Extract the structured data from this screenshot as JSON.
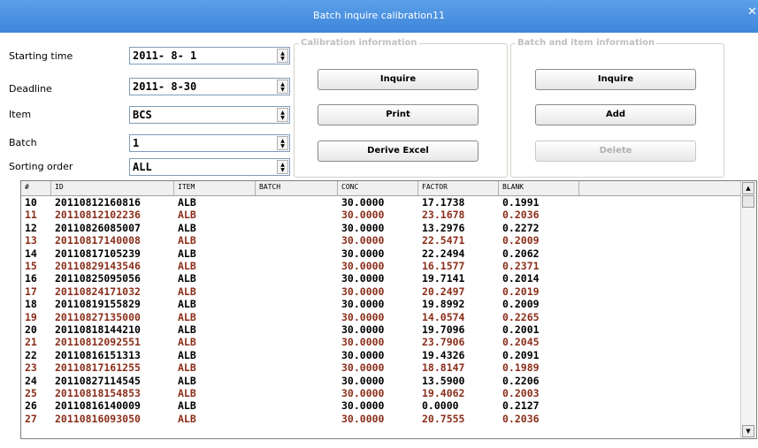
{
  "window": {
    "title": "Batch inquire calibration11"
  },
  "form": {
    "starting_time": {
      "label": "Starting time",
      "value": "2011- 8- 1"
    },
    "deadline": {
      "label": "Deadline",
      "value": "2011- 8-30"
    },
    "item": {
      "label": "Item",
      "value": "BCS"
    },
    "batch": {
      "label": "Batch",
      "value": "1"
    },
    "sorting_order": {
      "label": "Sorting order",
      "value": "ALL"
    }
  },
  "calibration_group": {
    "title": "Calibration information",
    "inquire": "Inquire",
    "print": "Print",
    "derive_excel": "Derive Excel"
  },
  "batch_group": {
    "title": "Batch and item information",
    "inquire": "Inquire",
    "add": "Add",
    "delete": "Delete"
  },
  "colors": {
    "title_bar": "#4a90e2",
    "odd_row_text": "#8b2e1a",
    "even_row_text": "#000000"
  },
  "table": {
    "columns": [
      "#",
      "ID",
      "ITEM",
      "BATCH",
      "CONC",
      "FACTOR",
      "BLANK"
    ],
    "rows": [
      [
        "10",
        "20110812160816",
        "ALB",
        "",
        "30.0000",
        "17.1738",
        "0.1991"
      ],
      [
        "11",
        "20110812102236",
        "ALB",
        "",
        "30.0000",
        "23.1678",
        "0.2036"
      ],
      [
        "12",
        "20110826085007",
        "ALB",
        "",
        "30.0000",
        "13.2976",
        "0.2272"
      ],
      [
        "13",
        "20110817140008",
        "ALB",
        "",
        "30.0000",
        "22.5471",
        "0.2009"
      ],
      [
        "14",
        "20110817105239",
        "ALB",
        "",
        "30.0000",
        "22.2494",
        "0.2062"
      ],
      [
        "15",
        "20110829143546",
        "ALB",
        "",
        "30.0000",
        "16.1577",
        "0.2371"
      ],
      [
        "16",
        "20110825095056",
        "ALB",
        "",
        "30.0000",
        "19.7141",
        "0.2014"
      ],
      [
        "17",
        "20110824171032",
        "ALB",
        "",
        "30.0000",
        "20.2497",
        "0.2019"
      ],
      [
        "18",
        "20110819155829",
        "ALB",
        "",
        "30.0000",
        "19.8992",
        "0.2009"
      ],
      [
        "19",
        "20110827135000",
        "ALB",
        "",
        "30.0000",
        "14.0574",
        "0.2265"
      ],
      [
        "20",
        "20110818144210",
        "ALB",
        "",
        "30.0000",
        "19.7096",
        "0.2001"
      ],
      [
        "21",
        "20110812092551",
        "ALB",
        "",
        "30.0000",
        "23.7906",
        "0.2045"
      ],
      [
        "22",
        "20110816151313",
        "ALB",
        "",
        "30.0000",
        "19.4326",
        "0.2091"
      ],
      [
        "23",
        "20110817161255",
        "ALB",
        "",
        "30.0000",
        "18.8147",
        "0.1989"
      ],
      [
        "24",
        "20110827114545",
        "ALB",
        "",
        "30.0000",
        "13.5900",
        "0.2206"
      ],
      [
        "25",
        "20110818154853",
        "ALB",
        "",
        "30.0000",
        "19.4062",
        "0.2003"
      ],
      [
        "26",
        "20110816140009",
        "ALB",
        "",
        "30.0000",
        "0.0000",
        "0.2127"
      ],
      [
        "27",
        "20110816093050",
        "ALB",
        "",
        "30.0000",
        "20.7555",
        "0.2036"
      ]
    ]
  }
}
